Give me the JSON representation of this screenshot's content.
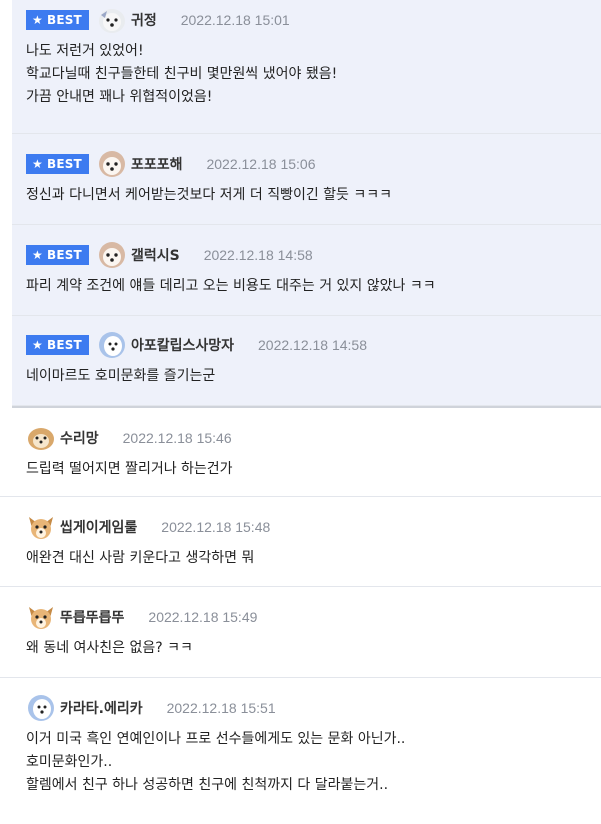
{
  "badge_label": "BEST",
  "colors": {
    "badge": "#3d7bf0",
    "best_bg": "#eef1fa",
    "date": "#8a8f99"
  },
  "comments": [
    {
      "best": true,
      "avatar": "bichon-avatar-icon",
      "nick": "귀정",
      "date": "2022.12.18 15:01",
      "lines": [
        "나도 저런거 있었어!",
        "학교다닐때 친구들한테 친구비 몇만원씩 냈어야 됐음!",
        "가끔 안내면 꽤나 위협적이었음!"
      ]
    },
    {
      "best": true,
      "avatar": "maltese-avatar-icon",
      "nick": "포포포해",
      "date": "2022.12.18 15:06",
      "lines": [
        "정신과 다니면서 케어받는것보다 저게 더 직빵이긴 할듯 ㅋㅋㅋ"
      ]
    },
    {
      "best": true,
      "avatar": "maltese-avatar-icon",
      "nick": "갤럭시S",
      "date": "2022.12.18 14:58",
      "lines": [
        "파리 계약 조건에 얘들 데리고 오는 비용도 대주는 거 있지 않았나 ㅋㅋ"
      ]
    },
    {
      "best": true,
      "avatar": "samoyed-avatar-icon",
      "nick": "아포칼립스사망자",
      "date": "2022.12.18 14:58",
      "lines": [
        "네이마르도 호미문화를 즐기는군"
      ]
    },
    {
      "best": false,
      "avatar": "pomeranian-avatar-icon",
      "nick": "수리망",
      "date": "2022.12.18 15:46",
      "lines": [
        "드립력 떨어지면 짤리거나 하는건가"
      ]
    },
    {
      "best": false,
      "avatar": "chihuahua-avatar-icon",
      "nick": "씹게이게임룰",
      "date": "2022.12.18 15:48",
      "lines": [
        "애완견 대신 사람 키운다고 생각하면 뭐"
      ]
    },
    {
      "best": false,
      "avatar": "chihuahua-avatar-icon",
      "nick": "뚜릅뚜릅뚜",
      "date": "2022.12.18 15:49",
      "lines": [
        "왜 동네 여사친은 없음? ㅋㅋ"
      ]
    },
    {
      "best": false,
      "avatar": "samoyed-avatar-icon",
      "nick": "카라타.에리카",
      "date": "2022.12.18 15:51",
      "lines": [
        "이거 미국 흑인 연예인이나 프로 선수들에게도 있는 문화 아닌가..",
        "호미문화인가..",
        "할렘에서 친구 하나 성공하면 친구에 친척까지 다 달라붙는거.."
      ]
    }
  ]
}
